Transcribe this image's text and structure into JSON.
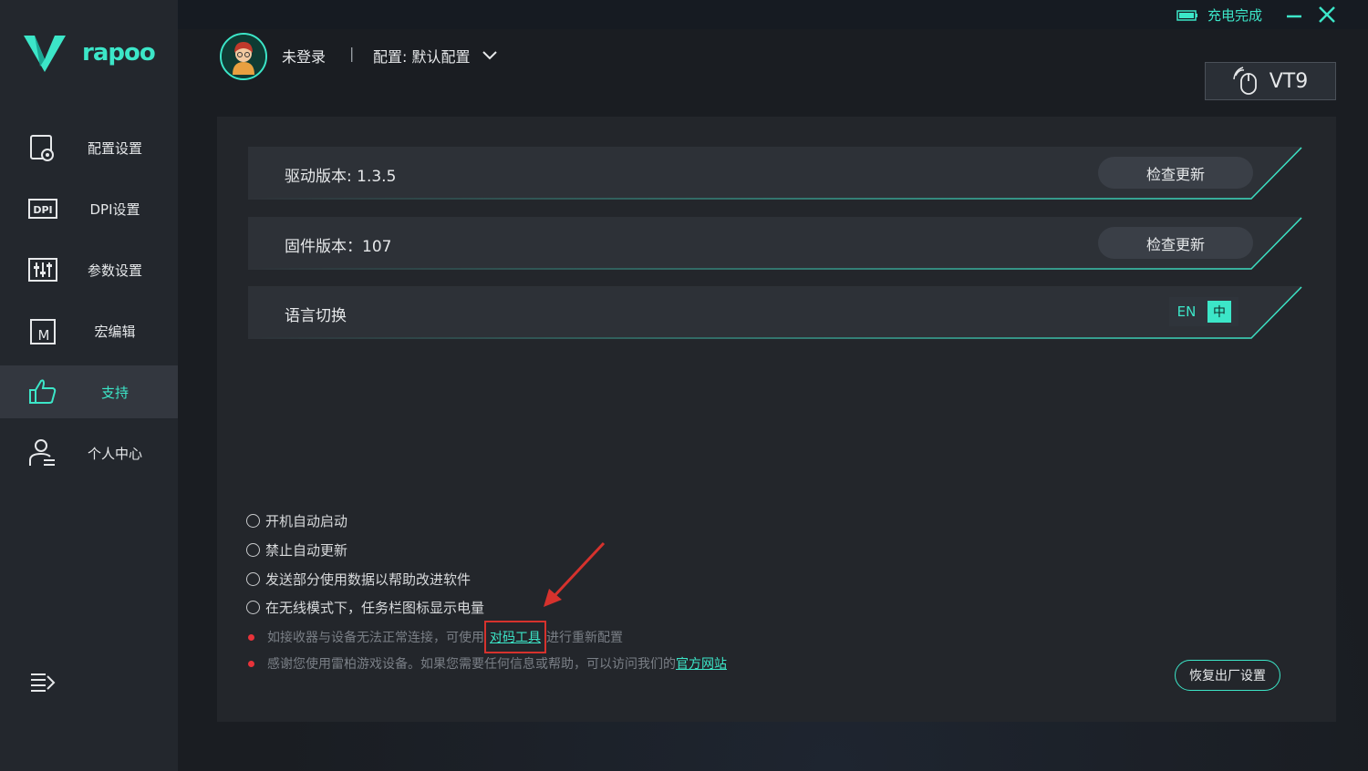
{
  "brand": {
    "name": "rapoo"
  },
  "sidebar": {
    "items": [
      {
        "label": "配置设置",
        "icon": "config-icon"
      },
      {
        "label": "DPI设置",
        "icon": "dpi-icon"
      },
      {
        "label": "参数设置",
        "icon": "params-icon"
      },
      {
        "label": "宏编辑",
        "icon": "macro-icon"
      },
      {
        "label": "支持",
        "icon": "thumbs-up-icon",
        "active": true
      },
      {
        "label": "个人中心",
        "icon": "user-icon"
      }
    ]
  },
  "header": {
    "status": "充电完成",
    "login": "未登录",
    "separator": "|",
    "profile": "配置: 默认配置",
    "device": "VT9"
  },
  "support": {
    "driver_version": "驱动版本: 1.3.5",
    "firmware_version": "固件版本：107",
    "check_update": "检查更新",
    "language_label": "语言切换",
    "lang_en": "EN",
    "lang_zh": "中",
    "options": [
      "开机自动启动",
      "禁止自动更新",
      "发送部分使用数据以帮助改进软件",
      "在无线模式下，任务栏图标显示电量"
    ],
    "note1_pre": "如接收器与设备无法正常连接，可使用",
    "note1_link": "对码工具",
    "note1_post": "进行重新配置",
    "note2_pre": "感谢您使用雷柏游戏设备。如果您需要任何信息或帮助，可以访问我们的",
    "note2_link": "官方网站",
    "reset": "恢复出厂设置"
  },
  "colors": {
    "accent": "#3ce6c8",
    "alert": "#e8333a",
    "highlight": "#d6322d"
  }
}
